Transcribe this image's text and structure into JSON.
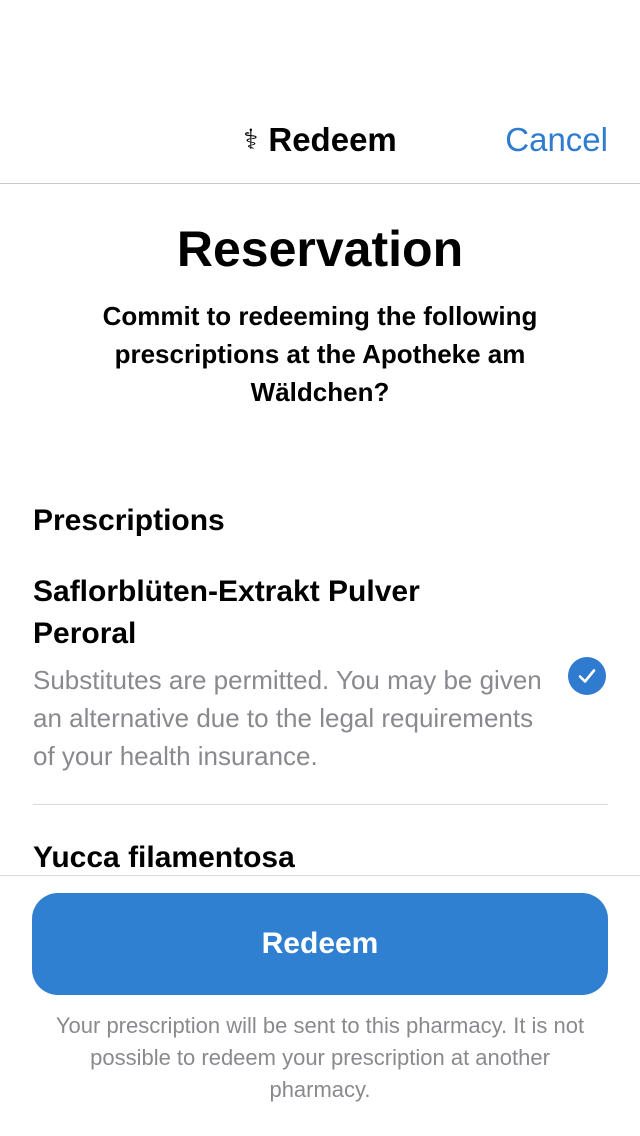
{
  "nav": {
    "title_glyph": "⚕",
    "title": "Redeem",
    "cancel_label": "Cancel"
  },
  "main": {
    "headline": "Reservation",
    "subtitle": "Commit to redeeming the following prescriptions at the Apotheke am Wäldchen?",
    "section_title": "Prescriptions",
    "prescriptions": [
      {
        "name": "Saflorblüten-Extrakt Pulver Peroral",
        "description": "Substitutes are permitted. You may be given an alternative due to the legal requirements of your health insurance.",
        "selected": true
      },
      {
        "name": "Yucca filamentosa"
      }
    ]
  },
  "footer": {
    "button_label": "Redeem",
    "note": "Your prescription will be sent to this pharmacy. It is not possible to redeem your prescription at another pharmacy."
  },
  "colors": {
    "accent": "#2f7bcf",
    "secondary_text": "#8a8a8e"
  }
}
